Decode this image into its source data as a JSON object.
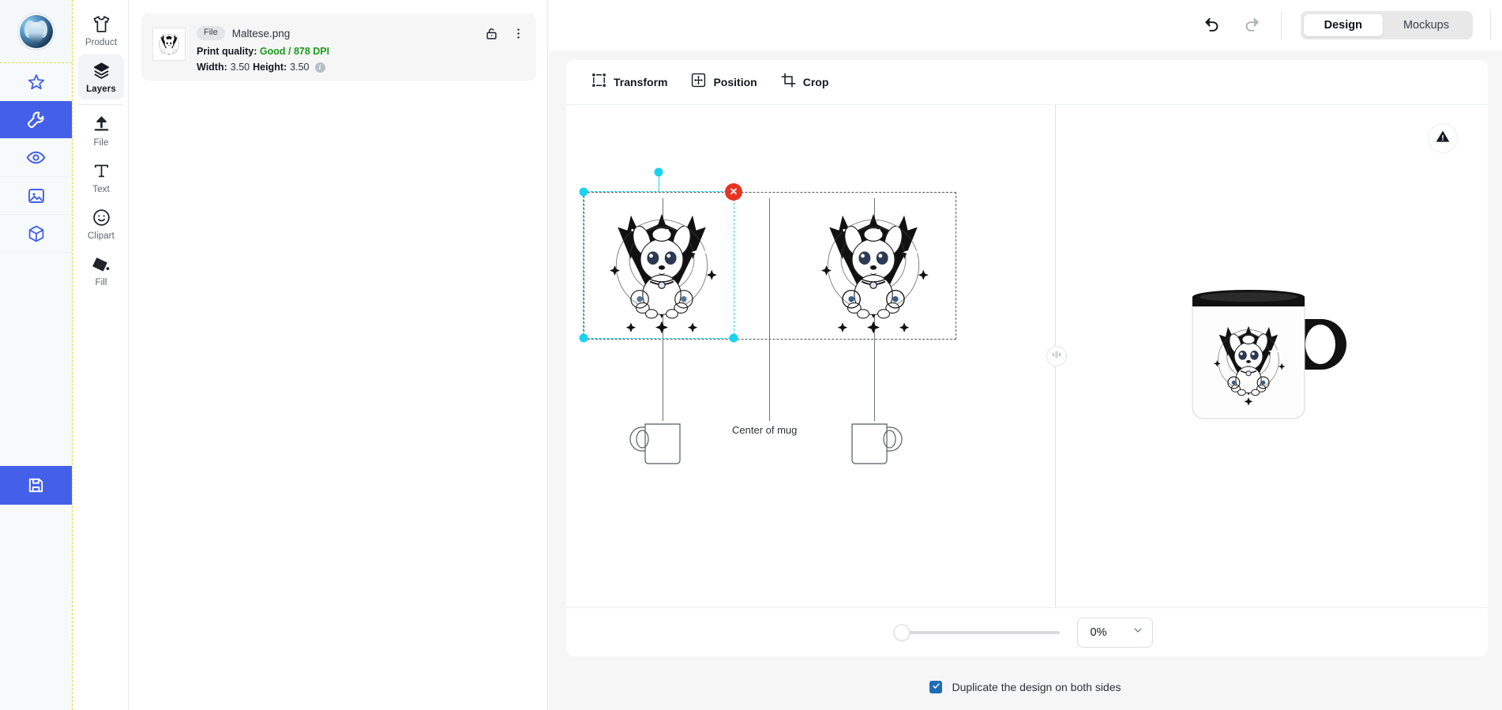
{
  "rail": {
    "avatar_name": "user-avatar",
    "items": [
      {
        "id": "favorites",
        "icon": "star-icon",
        "active": false
      },
      {
        "id": "tools",
        "icon": "wrench-icon",
        "active": true
      },
      {
        "id": "preview",
        "icon": "eye-icon",
        "active": false
      },
      {
        "id": "images",
        "icon": "image-icon",
        "active": false
      },
      {
        "id": "3d",
        "icon": "cube-icon",
        "active": false
      },
      {
        "id": "save",
        "icon": "save-icon",
        "active": true
      }
    ]
  },
  "tools": {
    "items": [
      {
        "label": "Product",
        "icon": "tshirt-icon",
        "selected": false
      },
      {
        "label": "Layers",
        "icon": "layers-icon",
        "selected": true
      },
      {
        "label": "File",
        "icon": "upload-icon",
        "selected": false
      },
      {
        "label": "Text",
        "icon": "text-icon",
        "selected": false
      },
      {
        "label": "Clipart",
        "icon": "smiley-icon",
        "selected": false
      },
      {
        "label": "Fill",
        "icon": "paint-bucket-icon",
        "selected": false
      }
    ]
  },
  "layer": {
    "type_pill": "File",
    "filename": "Maltese.png",
    "print_quality_label": "Print quality:",
    "print_quality_value": "Good / 878 DPI",
    "print_quality_color": "#1a9c1a",
    "width_label": "Width:",
    "width_value": "3.50",
    "height_label": "Height:",
    "height_value": "3.50",
    "lock_icon": "unlock-icon",
    "menu_icon": "more-vertical-icon"
  },
  "topbar": {
    "undo_icon": "undo-icon",
    "redo_icon": "redo-icon",
    "tabs": [
      {
        "label": "Design",
        "active": true
      },
      {
        "label": "Mockups",
        "active": false
      }
    ]
  },
  "canvas_toolbar": {
    "items": [
      {
        "label": "Transform",
        "icon": "transform-icon",
        "active": false
      },
      {
        "label": "Position",
        "icon": "position-icon",
        "active": true
      },
      {
        "label": "Crop",
        "icon": "crop-icon",
        "active": false
      }
    ]
  },
  "stage": {
    "warning_icon": "warning-triangle-icon",
    "center_label": "Center of mug",
    "delete_icon": "delete-x-icon",
    "divider_icon": "resize-horizontal-icon",
    "selection_color": "#19d3ef",
    "delete_color": "#ea3323",
    "mug_left_name": "mug-outline-left",
    "mug_right_name": "mug-outline-right",
    "preview_mug_name": "mug-mockup-preview"
  },
  "zoom": {
    "value": "0%",
    "slider_percent": 0,
    "chevron_icon": "chevron-down-icon"
  },
  "footer": {
    "checkbox_checked": true,
    "checkbox_label": "Duplicate the design on both sides",
    "check_icon": "check-icon",
    "accent_color": "#1e6bb8"
  }
}
